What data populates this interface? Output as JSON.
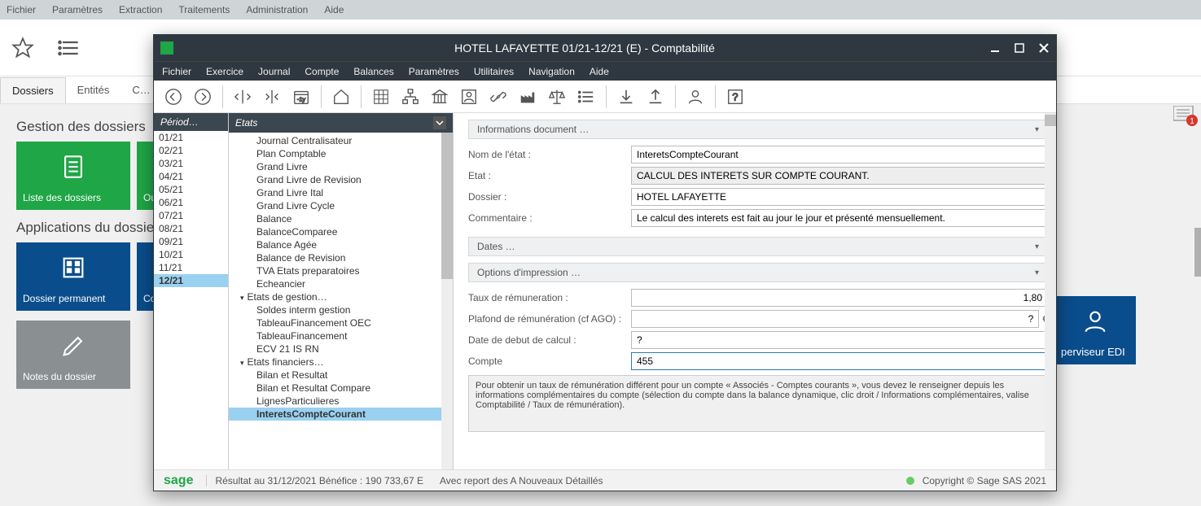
{
  "bg_menu": [
    "Fichier",
    "Paramètres",
    "Extraction",
    "Traitements",
    "Administration",
    "Aide"
  ],
  "bg_tabs": {
    "active": "Dossiers",
    "items": [
      "Dossiers",
      "Entités",
      "C…"
    ]
  },
  "bg_section1": "Gestion des dossiers",
  "tiles1": [
    {
      "label": "Liste des dossiers",
      "color": "green",
      "icon": "document"
    },
    {
      "label": "Ouv…",
      "color": "green",
      "icon": "folder"
    }
  ],
  "bg_section2": "Applications du dossier",
  "tiles2": [
    {
      "label": "Dossier permanent",
      "color": "blue",
      "icon": "building"
    },
    {
      "label": "Co…",
      "color": "blue",
      "icon": ""
    }
  ],
  "tiles3": [
    {
      "label": "Notes du dossier",
      "color": "gray",
      "icon": "pencil"
    }
  ],
  "tile_right": {
    "label": "perviseur EDI",
    "icon": "person"
  },
  "modal": {
    "title": "HOTEL LAFAYETTE 01/21-12/21 (E) - Comptabilité",
    "menu": [
      "Fichier",
      "Exercice",
      "Journal",
      "Compte",
      "Balances",
      "Paramètres",
      "Utilitaires",
      "Navigation",
      "Aide"
    ],
    "period_header": "Périod…",
    "periods": [
      "01/21",
      "02/21",
      "03/21",
      "04/21",
      "05/21",
      "06/21",
      "07/21",
      "08/21",
      "09/21",
      "10/21",
      "11/21",
      "12/21"
    ],
    "period_selected": "12/21",
    "etats_header": "Etats",
    "etats": [
      {
        "label": "Journal Centralisateur",
        "t": "i"
      },
      {
        "label": "Plan Comptable",
        "t": "i"
      },
      {
        "label": "Grand Livre",
        "t": "i"
      },
      {
        "label": "Grand Livre de Revision",
        "t": "i"
      },
      {
        "label": "Grand Livre Ital",
        "t": "i"
      },
      {
        "label": "Grand Livre Cycle",
        "t": "i"
      },
      {
        "label": "Balance",
        "t": "i"
      },
      {
        "label": "BalanceComparee",
        "t": "i"
      },
      {
        "label": "Balance Agée",
        "t": "i"
      },
      {
        "label": "Balance de Revision",
        "t": "i"
      },
      {
        "label": "TVA Etats preparatoires",
        "t": "i"
      },
      {
        "label": "Echeancier",
        "t": "i"
      },
      {
        "label": "Etats de gestion…",
        "t": "g"
      },
      {
        "label": "Soldes interm gestion",
        "t": "i"
      },
      {
        "label": "TableauFinancement OEC",
        "t": "i"
      },
      {
        "label": "TableauFinancement",
        "t": "i"
      },
      {
        "label": "ECV 21 IS RN",
        "t": "i"
      },
      {
        "label": "Etats financiers…",
        "t": "g"
      },
      {
        "label": "Bilan et Resultat",
        "t": "i"
      },
      {
        "label": "Bilan et Resultat Compare",
        "t": "i"
      },
      {
        "label": "LignesParticulieres",
        "t": "i"
      },
      {
        "label": "InteretsCompteCourant",
        "t": "i",
        "sel": true
      }
    ],
    "sections": {
      "info": "Informations document …",
      "dates": "Dates …",
      "options": "Options d'impression …"
    },
    "form": {
      "nom_label": "Nom de l'état :",
      "nom_value": "InteretsCompteCourant",
      "etat_label": "Etat :",
      "etat_value": "CALCUL DES INTERETS SUR COMPTE COURANT.",
      "dossier_label": "Dossier :",
      "dossier_value": "HOTEL LAFAYETTE",
      "comment_label": "Commentaire :",
      "comment_value": "Le calcul des interets est fait au jour le jour et présenté mensuellement.",
      "taux_label": "Taux de rémuneration :",
      "taux_value": "1,80",
      "plafond_label": "Plafond de rémunération (cf AGO) :",
      "plafond_value": "?",
      "plafond_suffix": "€",
      "datedeb_label": "Date de debut de calcul :",
      "datedeb_value": "?",
      "compte_label": "Compte",
      "compte_value": "455",
      "help": "Pour obtenir un taux de rémunération différent pour un compte « Associés - Comptes courants », vous devez le renseigner depuis les informations complémentaires du compte (sélection du compte dans la balance dynamique, clic droit / Informations complémentaires, valise Comptabilité / Taux de rémunération)."
    },
    "status": {
      "logo": "sage",
      "result": "Résultat au 31/12/2021 Bénéfice : 190 733,67 E",
      "report": "Avec report des A Nouveaux Détaillés",
      "copyright": "Copyright © Sage SAS 2021"
    }
  },
  "badge_count": "1"
}
